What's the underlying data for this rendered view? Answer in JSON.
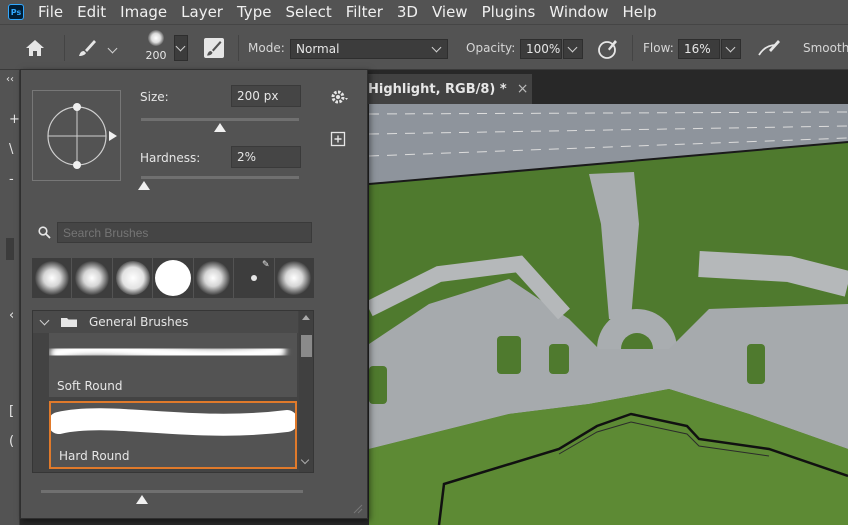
{
  "menu": [
    "File",
    "Edit",
    "Image",
    "Layer",
    "Type",
    "Select",
    "Filter",
    "3D",
    "View",
    "Plugins",
    "Window",
    "Help"
  ],
  "app_logo": "Ps",
  "options_bar": {
    "brush_size_preview": "200",
    "mode_label": "Mode:",
    "mode_value": "Normal",
    "opacity_label": "Opacity:",
    "opacity_value": "100%",
    "flow_label": "Flow:",
    "flow_value": "16%",
    "smoothing_label": "Smoothi"
  },
  "document_tab": {
    "title": "Highlight, RGB/8) *",
    "close": "×"
  },
  "brush_panel": {
    "size_label": "Size:",
    "size_value": "200 px",
    "size_level": 0.5,
    "hardness_label": "Hardness:",
    "hardness_value": "2%",
    "hardness_level": 0.02,
    "search_placeholder": "Search Brushes",
    "group_name": "General Brushes",
    "brushes": [
      {
        "name": "Soft Round",
        "selected": false
      },
      {
        "name": "Hard Round",
        "selected": true
      }
    ],
    "accent_color": "#e07a2b"
  },
  "icons": [
    "home-icon",
    "brush-icon",
    "brush-settings-icon",
    "airbrush-icon",
    "pressure-icon",
    "gear-icon",
    "new-preset-icon",
    "search-icon"
  ]
}
